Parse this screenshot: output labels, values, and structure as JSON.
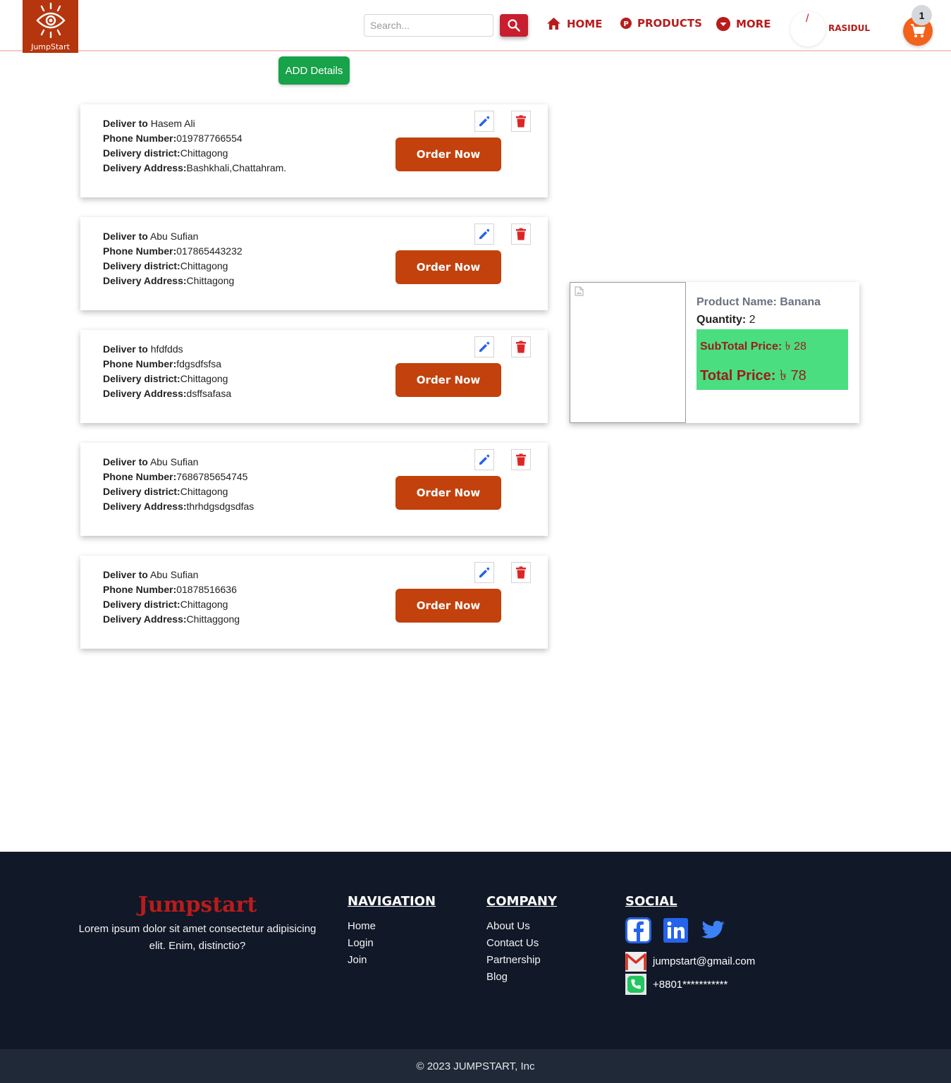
{
  "header": {
    "logo_text": "JumpStart",
    "search_placeholder": "Search...",
    "nav": [
      {
        "label": "HOME",
        "icon": "home-icon"
      },
      {
        "label": "PRODUCTS",
        "icon": "products-icon"
      },
      {
        "label": "MORE",
        "icon": "chevron-down-icon"
      }
    ],
    "avatar_glyph": "/",
    "username": "RASIDUL",
    "cart_count": "1"
  },
  "add_details_label": "ADD Details",
  "addresses": [
    {
      "deliver_label": "Deliver to",
      "name": "Hasem Ali",
      "phone_label": "Phone Number:",
      "phone": "019787766554",
      "district_label": "Delivery district:",
      "district": "Chittagong",
      "address_label": "Delivery Address:",
      "address": "Bashkhali,Chattahram.",
      "order_label": "Order Now"
    },
    {
      "deliver_label": "Deliver to",
      "name": "Abu Sufian",
      "phone_label": "Phone Number:",
      "phone": "017865443232",
      "district_label": "Delivery district:",
      "district": "Chittagong",
      "address_label": "Delivery Address:",
      "address": "Chittagong",
      "order_label": "Order Now"
    },
    {
      "deliver_label": "Deliver to",
      "name": "hfdfdds",
      "phone_label": "Phone Number:",
      "phone": "fdgsdfsfsa",
      "district_label": "Delivery district:",
      "district": "Chittagong",
      "address_label": "Delivery Address:",
      "address": "dsffsafasa",
      "order_label": "Order Now"
    },
    {
      "deliver_label": "Deliver to",
      "name": "Abu Sufian",
      "phone_label": "Phone Number:",
      "phone": "7686785654745",
      "district_label": "Delivery district:",
      "district": "Chittagong",
      "address_label": "Delivery Address:",
      "address": "thrhdgsdgsdfas",
      "order_label": "Order Now"
    },
    {
      "deliver_label": "Deliver to",
      "name": "Abu Sufian",
      "phone_label": "Phone Number:",
      "phone": "01878516636",
      "district_label": "Delivery district:",
      "district": "Chittagong",
      "address_label": "Delivery Address:",
      "address": "Chittaggong",
      "order_label": "Order Now"
    }
  ],
  "product": {
    "name_label": "Product Name:",
    "name": "Banana",
    "qty_label": "Quantity:",
    "qty": "2",
    "subtotal_label": "SubTotal Price:",
    "subtotal": "৳ 28",
    "total_label": "Total Price:",
    "total": "৳ 78"
  },
  "footer": {
    "brand": "Jumpstart",
    "desc": "Lorem ipsum dolor sit amet consectetur adipisicing elit. Enim, distinctio?",
    "navigation": {
      "heading": "NAVIGATION",
      "links": [
        "Home",
        "Login",
        "Join"
      ]
    },
    "company": {
      "heading": "COMPANY",
      "links": [
        "About Us",
        "Contact Us",
        "Partnership",
        "Blog"
      ]
    },
    "social": {
      "heading": "SOCIAL",
      "email": "jumpstart@gmail.com",
      "phone": "+8801***********"
    },
    "copyright": "© 2023 JUMPSTART, Inc"
  },
  "colors": {
    "brand_red": "#b71c1c",
    "logo_bg": "#b5350e",
    "order_button": "#c2410c",
    "add_button": "#18a24a",
    "price_box": "#4ade80",
    "footer_bg": "#111827",
    "copyright_bg": "#1f2937",
    "cart": "#f2621b"
  }
}
